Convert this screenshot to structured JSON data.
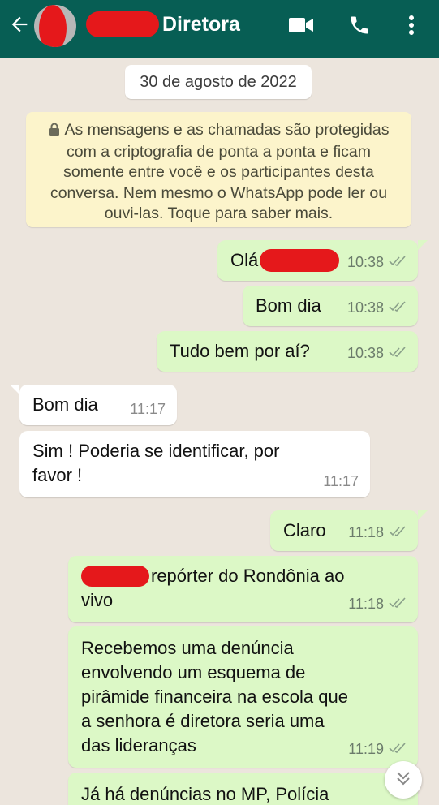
{
  "header": {
    "title": "Diretora",
    "colors": {
      "bar": "#075e54",
      "redaction": "#e5181b"
    },
    "icons": [
      "back-arrow-icon",
      "video-call-icon",
      "phone-icon",
      "more-vert-icon"
    ]
  },
  "chat": {
    "date": "30 de agosto de 2022",
    "encryption_notice": "As mensagens e as chamadas são protegidas com a criptografia de ponta a ponta e ficam somente entre você e os participantes desta conversa. Nem mesmo o WhatsApp pode ler ou ouvi-las. Toque para saber mais.",
    "messages": [
      {
        "direction": "out",
        "text": "Olá",
        "time": "10:38"
      },
      {
        "direction": "out",
        "text": "Bom dia",
        "time": "10:38"
      },
      {
        "direction": "out",
        "text": "Tudo bem por aí?",
        "time": "10:38"
      },
      {
        "direction": "in",
        "text": "Bom dia",
        "time": "11:17"
      },
      {
        "direction": "in",
        "line1": "Sim ! Poderia se identificar,  por",
        "line2": "favor !",
        "time": "11:17"
      },
      {
        "direction": "out",
        "text": "Claro",
        "time": "11:18"
      },
      {
        "direction": "out",
        "line1": "repórter do Rondônia ao",
        "line2": "vivo",
        "time": "11:18"
      },
      {
        "direction": "out",
        "lines": [
          "Recebemos uma denúncia",
          "envolvendo um esquema de",
          "pirâmide financeira na escola que",
          "a senhora é diretora seria uma",
          "das lideranças"
        ],
        "time": "11:19"
      },
      {
        "direction": "out",
        "text": "Já há denúncias no MP, Polícia"
      }
    ],
    "colors": {
      "outgoing": "#dcf8c6",
      "incoming": "#ffffff",
      "background": "#ece5dd",
      "notice": "#fcf4cb"
    }
  }
}
